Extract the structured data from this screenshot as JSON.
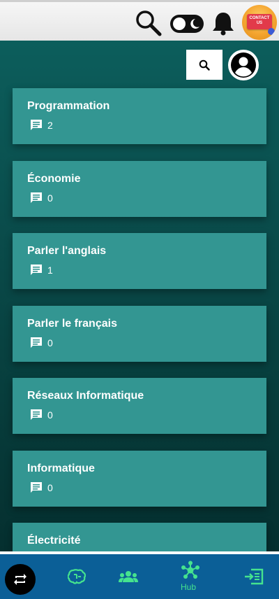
{
  "topbar": {
    "icons": [
      "search-icon",
      "dark-mode-toggle-icon",
      "bell-icon",
      "contact-us-icon"
    ],
    "contact_text": "CONTACT US"
  },
  "main": {
    "cards": [
      {
        "title": "Programmation",
        "count": "2"
      },
      {
        "title": "Économie",
        "count": "0"
      },
      {
        "title": "Parler l'anglais",
        "count": "1"
      },
      {
        "title": "Parler le français",
        "count": "0"
      },
      {
        "title": "Réseaux Informatique",
        "count": "0"
      },
      {
        "title": "Informatique",
        "count": "0"
      },
      {
        "title": "Électricité",
        "count": ""
      }
    ]
  },
  "bottom_nav": {
    "items": [
      "swap-icon",
      "brain-icon",
      "group-icon",
      "hub-icon",
      "login-icon"
    ],
    "hub_label": "Hub"
  },
  "colors": {
    "card": "#339692",
    "nav_bg": "#0b5f97",
    "nav_accent": "#45e38e"
  }
}
